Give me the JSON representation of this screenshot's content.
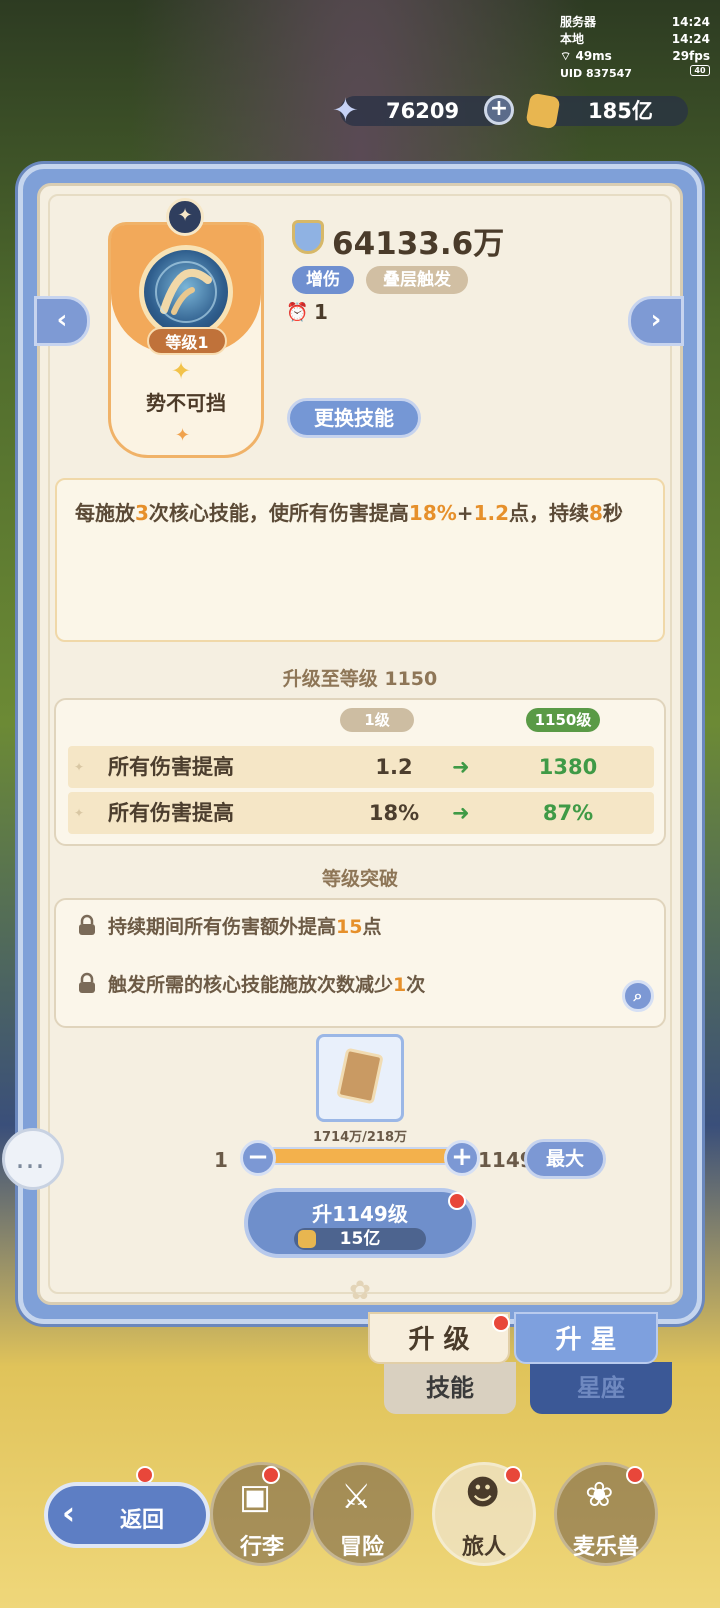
{
  "hud": {
    "server_label": "服务器",
    "server_time": "14:24",
    "local_label": "本地",
    "local_time": "14:24",
    "ping": "49ms",
    "fps": "29fps",
    "uid": "UID 837547",
    "battery": "40"
  },
  "resources": {
    "stars": "76209",
    "gold": "185亿"
  },
  "skill": {
    "level_label": "等级1",
    "name": "势不可挡",
    "power": "64133.6万",
    "tags": [
      "增伤",
      "叠层触发"
    ],
    "cooldown": "1",
    "change_label": "更换技能"
  },
  "desc": {
    "p1": "每施放",
    "n1": "3",
    "p2": "次核心技能，使所有伤害提高",
    "n2": "18%",
    "p3": "+",
    "n3": "1.2",
    "p4": "点，持续",
    "n4": "8",
    "p5": "秒"
  },
  "upgrade": {
    "title": "升级至等级 1150",
    "from_level": "1级",
    "to_level": "1150级",
    "rows": [
      {
        "label": "所有伤害提高",
        "from": "1.2",
        "to": "1380"
      },
      {
        "label": "所有伤害提高",
        "from": "18%",
        "to": "87%"
      }
    ]
  },
  "breakthrough": {
    "title": "等级突破",
    "items": [
      {
        "a": "持续期间所有伤害额外提高",
        "n": "15",
        "b": "点"
      },
      {
        "a": "触发所需的核心技能施放次数减少",
        "n": "1",
        "b": "次"
      }
    ]
  },
  "cost": {
    "owned": "1714万",
    "needed": "218万",
    "min": "1",
    "max": "1149",
    "max_label": "最大"
  },
  "upgrade_btn": {
    "label": "升1149级",
    "cost": "15亿"
  },
  "tabs": {
    "main": [
      "升 级",
      "升 星"
    ],
    "sub": [
      "技能",
      "星座"
    ]
  },
  "nav": [
    "返回",
    "行李",
    "冒险",
    "旅人",
    "麦乐兽"
  ],
  "colors": {
    "panel_blue": "#7fa0d8",
    "highlight": "#e6902b",
    "green": "#3f9a46",
    "card_orange": "#f2a95a"
  }
}
